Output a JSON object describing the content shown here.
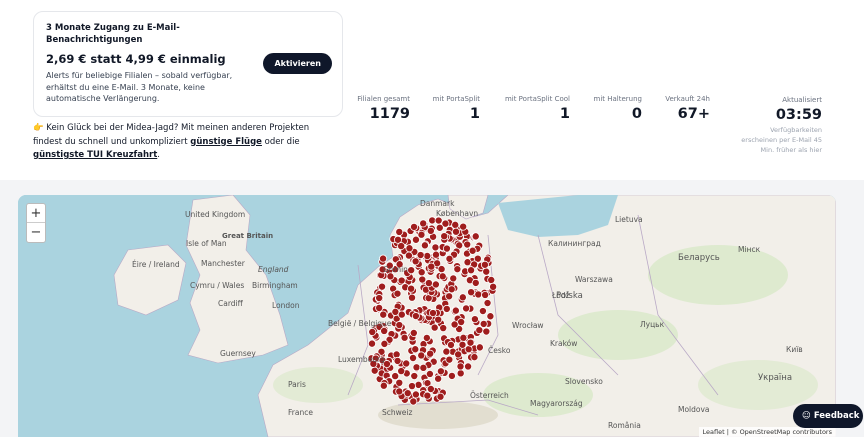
{
  "promo": {
    "title": "3 Monate Zugang zu E-Mail-Benachrichtigungen",
    "price": "2,69 € statt 4,99 € einmalig",
    "description": "Alerts für beliebige Filialen – sobald verfügbar, erhältst du eine E-Mail. 3 Monate, keine automatische Verlängerung.",
    "button": "Aktivieren"
  },
  "hint": {
    "emoji": "👉",
    "text1": "Kein Glück bei der Midea-Jagd? Mit meinen anderen Projekten findest du schnell und unkompliziert",
    "link1": "günstige Flüge",
    "text2": "oder die",
    "link2": "günstigste TUI Kreuzfahrt",
    "text3": "."
  },
  "stats": [
    {
      "label": "Filialen gesamt",
      "value": "1179"
    },
    {
      "label": "mit PortaSplit",
      "value": "1"
    },
    {
      "label": "mit PortaSplit Cool",
      "value": "1"
    },
    {
      "label": "mit Halterung",
      "value": "0"
    },
    {
      "label": "Verkauft 24h",
      "value": "67+"
    }
  ],
  "updated": {
    "label": "Aktualisiert",
    "value": "03:59",
    "note_lines": [
      "Verfügbarkeiten",
      "erscheinen per E-Mail 45",
      "Min. früher als hier"
    ]
  },
  "map": {
    "zoom_in": "+",
    "zoom_out": "−",
    "attribution": "Leaflet | © OpenStreetMap contributors",
    "labels": {
      "uk": "United Kingdom",
      "gb": "Great Britain",
      "ire": "Éire / Ireland",
      "iom": "Isle of Man",
      "man": "Manchester",
      "eng": "England",
      "bir": "Birmingham",
      "wal": "Cymru / Wales",
      "car": "Cardiff",
      "lon": "London",
      "gue": "Guernsey",
      "bel": "België / Belgique",
      "lux": "Luxembourg",
      "fra": "France",
      "par": "Paris",
      "swi": "Schweiz",
      "kob": "København",
      "dan": "Danmark",
      "lie": "Lietuva",
      "kal": "Калининград",
      "gro": "Gronin",
      "pol": "Polska",
      "war": "Warszawa",
      "lod": "Łódź",
      "wro": "Wrocław",
      "kra": "Kraków",
      "bel2": "Беларусь",
      "min": "Мінск",
      "lut": "Луцьк",
      "ces": "Česko",
      "slo": "Slovensko",
      "ost": "Österreich",
      "mag": "Magyarország",
      "ukr": "Україна",
      "kyi": "Київ",
      "mol": "Moldova",
      "ros": "România"
    },
    "marker_color": "#9f1d1d"
  },
  "feedback": "Feedback"
}
